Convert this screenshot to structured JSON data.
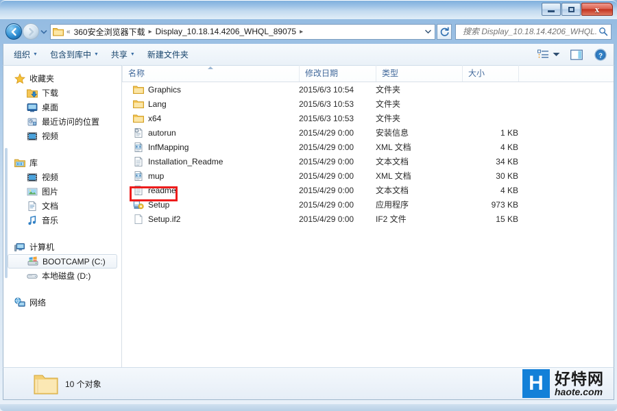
{
  "window": {
    "ghost_title": "",
    "buttons": {
      "minimize": "minimize-button",
      "maximize": "maximize-button",
      "close_label": "x"
    }
  },
  "navbar": {
    "back_label": "←",
    "forward_label": "→",
    "history_caret": "▼",
    "breadcrumb": {
      "overflow": "«",
      "items": [
        "360安全浏览器下载",
        "Display_10.18.14.4206_WHQL_89075"
      ],
      "separator": "▸",
      "trailing_separator": "▸"
    },
    "address_caret": "▼",
    "refresh_label": "↻",
    "search": {
      "placeholder": "搜索 Display_10.18.14.4206_WHQL...",
      "value": ""
    }
  },
  "toolbar": {
    "items": [
      {
        "label": "组织",
        "caret": "▼"
      },
      {
        "label": "包含到库中",
        "caret": "▼"
      },
      {
        "label": "共享",
        "caret": "▼"
      },
      {
        "label": "新建文件夹",
        "caret": ""
      }
    ],
    "view_caret": "▼"
  },
  "sidebar": {
    "groups": [
      {
        "header": {
          "label": "收藏夹",
          "icon": "star-icon"
        },
        "children": [
          {
            "label": "下载",
            "icon": "downloads-icon"
          },
          {
            "label": "桌面",
            "icon": "desktop-icon"
          },
          {
            "label": "最近访问的位置",
            "icon": "recent-places-icon"
          },
          {
            "label": "视频",
            "icon": "video-icon"
          }
        ]
      },
      {
        "header": {
          "label": "库",
          "icon": "library-icon"
        },
        "children": [
          {
            "label": "视频",
            "icon": "video-icon"
          },
          {
            "label": "图片",
            "icon": "pictures-icon"
          },
          {
            "label": "文档",
            "icon": "documents-icon"
          },
          {
            "label": "音乐",
            "icon": "music-icon"
          }
        ]
      },
      {
        "header": {
          "label": "计算机",
          "icon": "computer-icon"
        },
        "children": [
          {
            "label": "BOOTCAMP (C:)",
            "icon": "windows-drive-icon",
            "selected": true
          },
          {
            "label": "本地磁盘 (D:)",
            "icon": "drive-icon",
            "selected": false
          }
        ]
      },
      {
        "header": {
          "label": "网络",
          "icon": "network-icon"
        },
        "children": []
      }
    ]
  },
  "filelist": {
    "columns": [
      "名称",
      "修改日期",
      "类型",
      "大小"
    ],
    "sorted_column": "名称",
    "sort_direction": "ascending",
    "rows": [
      {
        "name": "Graphics",
        "date": "2015/6/3 10:54",
        "type": "文件夹",
        "size": "",
        "icon": "folder-icon"
      },
      {
        "name": "Lang",
        "date": "2015/6/3 10:53",
        "type": "文件夹",
        "size": "",
        "icon": "folder-icon"
      },
      {
        "name": "x64",
        "date": "2015/6/3 10:53",
        "type": "文件夹",
        "size": "",
        "icon": "folder-icon"
      },
      {
        "name": "autorun",
        "date": "2015/4/29 0:00",
        "type": "安装信息",
        "size": "1 KB",
        "icon": "setup-information-icon"
      },
      {
        "name": "InfMapping",
        "date": "2015/4/29 0:00",
        "type": "XML 文档",
        "size": "4 KB",
        "icon": "xml-document-icon"
      },
      {
        "name": "Installation_Readme",
        "date": "2015/4/29 0:00",
        "type": "文本文档",
        "size": "34 KB",
        "icon": "text-document-icon"
      },
      {
        "name": "mup",
        "date": "2015/4/29 0:00",
        "type": "XML 文档",
        "size": "30 KB",
        "icon": "xml-document-icon"
      },
      {
        "name": "readme",
        "date": "2015/4/29 0:00",
        "type": "文本文档",
        "size": "4 KB",
        "icon": "text-document-icon"
      },
      {
        "name": "Setup",
        "date": "2015/4/29 0:00",
        "type": "应用程序",
        "size": "973 KB",
        "icon": "application-icon",
        "highlighted": true
      },
      {
        "name": "Setup.if2",
        "date": "2015/4/29 0:00",
        "type": "IF2 文件",
        "size": "15 KB",
        "icon": "generic-file-icon"
      }
    ]
  },
  "statusbar": {
    "text": "10 个对象"
  },
  "watermark": {
    "logo_letter": "H",
    "cn": "好特网",
    "en": "haote.com"
  },
  "colors": {
    "annotation_red": "#ee1c1c",
    "accent_blue": "#1380d8",
    "header_text": "#41699b",
    "close_red": "#c2331f"
  }
}
